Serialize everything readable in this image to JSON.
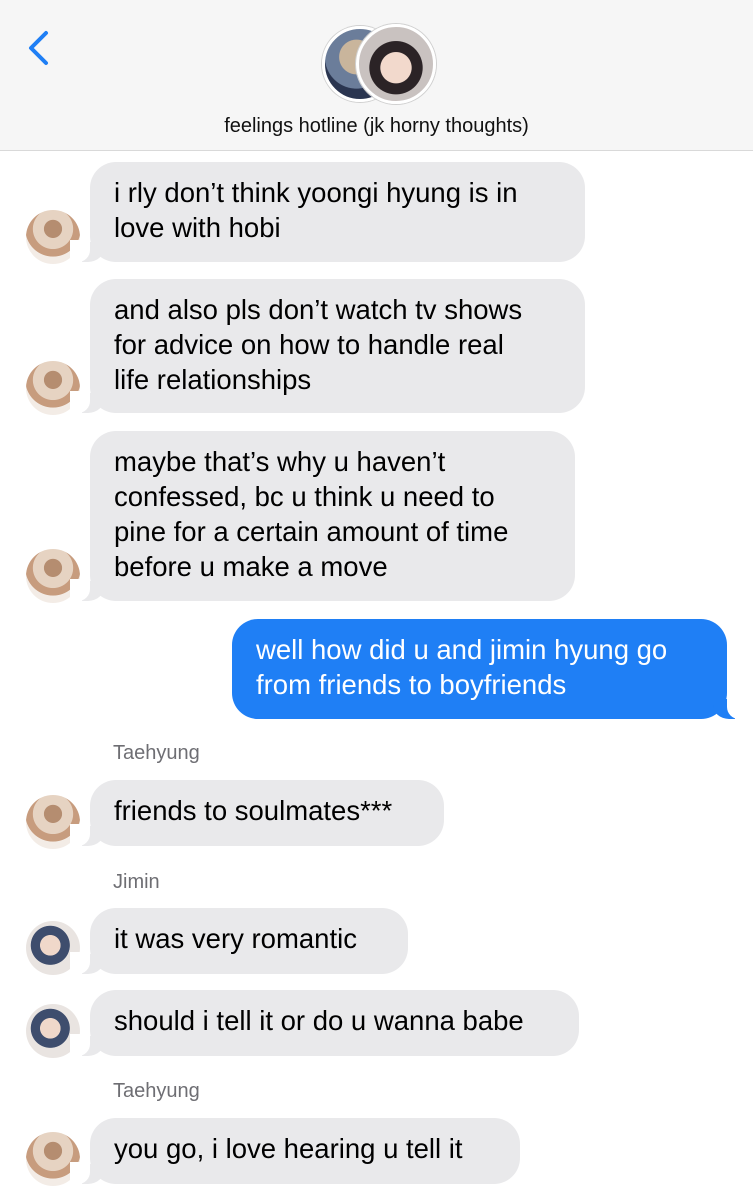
{
  "header": {
    "back_icon": "chevron-left-icon",
    "group_title": "feelings hotline (jk horny thoughts)",
    "accent": "#1f7ff5"
  },
  "messages": [
    {
      "direction": "in",
      "avatar": "taehyung",
      "lines": [
        "i rly don’t think yoongi hyung is in",
        "love with hobi"
      ]
    },
    {
      "direction": "in",
      "avatar": "taehyung",
      "lines": [
        "and also pls don’t watch tv shows",
        "for advice on how to handle real",
        "life relationships"
      ]
    },
    {
      "direction": "in",
      "avatar": "taehyung",
      "lines": [
        "maybe that’s why u haven’t",
        "confessed, bc u think u need to",
        "pine for a certain amount of time",
        "before u make a move"
      ]
    },
    {
      "direction": "out",
      "lines": [
        "well how did u and jimin hyung go",
        "from friends to boyfriends"
      ]
    },
    {
      "direction": "in",
      "sender": "Taehyung",
      "avatar": "taehyung",
      "lines": [
        "friends to soulmates***"
      ]
    },
    {
      "direction": "in",
      "sender": "Jimin",
      "avatar": "jimin",
      "lines": [
        "it was very romantic"
      ]
    },
    {
      "direction": "in",
      "avatar": "jimin",
      "lines": [
        "should i tell it or do u wanna babe"
      ]
    },
    {
      "direction": "in",
      "sender": "Taehyung",
      "avatar": "taehyung",
      "lines": [
        "you go, i love hearing u tell it"
      ]
    }
  ],
  "colors": {
    "incoming_bubble": "#e9e9eb",
    "outgoing_bubble": "#1f7ff5"
  }
}
